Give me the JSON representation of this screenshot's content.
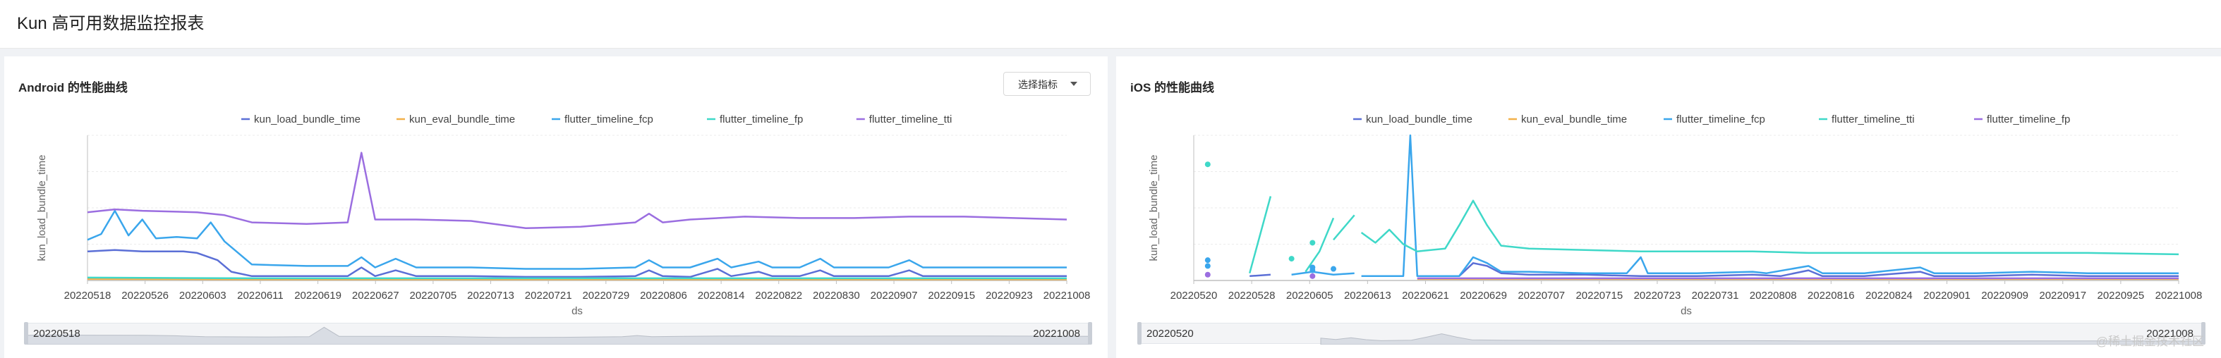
{
  "page": {
    "title": "Kun 高可用数据监控报表"
  },
  "watermark": "@稀土掘金技术社区",
  "panels": {
    "left": {
      "title": "Android 的性能曲线",
      "select_label": "选择指标",
      "slider": {
        "start": "20220518",
        "end": "20221008"
      }
    },
    "right": {
      "title": "iOS 的性能曲线",
      "slider": {
        "start": "20220520",
        "end": "20221008"
      }
    }
  },
  "colors": {
    "purple": "#9b6ee0",
    "blue": "#3aa6ec",
    "navy": "#5b6fd6",
    "teal": "#3fd8c8",
    "orange": "#f2b04a",
    "grid": "#ebebeb"
  },
  "chart_data": [
    {
      "type": "line",
      "ylabel": "kun_load_bundle_time",
      "xlabel": "ds",
      "legend": "top",
      "grid": true,
      "x_ticks": [
        "20220518",
        "20220526",
        "20220603",
        "20220611",
        "20220619",
        "20220627",
        "20220705",
        "20220713",
        "20220721",
        "20220729",
        "20220806",
        "20220814",
        "20220822",
        "20220830",
        "20220907",
        "20220915",
        "20220923",
        "20221008"
      ],
      "x_range": [
        "20220518",
        "20221008"
      ],
      "ylim": [
        0,
        100
      ],
      "series": [
        {
          "name": "kun_load_bundle_time",
          "color": "#5b6fd6",
          "points": [
            [
              "20220518",
              20
            ],
            [
              "20220522",
              21
            ],
            [
              "20220526",
              20
            ],
            [
              "20220601",
              20
            ],
            [
              "20220603",
              19
            ],
            [
              "20220606",
              14
            ],
            [
              "20220608",
              6
            ],
            [
              "20220611",
              3
            ],
            [
              "20220619",
              3
            ],
            [
              "20220625",
              3
            ],
            [
              "20220627",
              9
            ],
            [
              "20220629",
              3
            ],
            [
              "20220702",
              7
            ],
            [
              "20220705",
              3
            ],
            [
              "20220713",
              3
            ],
            [
              "20220721",
              2.5
            ],
            [
              "20220729",
              2.5
            ],
            [
              "20220806",
              3
            ],
            [
              "20220808",
              7
            ],
            [
              "20220810",
              3
            ],
            [
              "20220814",
              2.5
            ],
            [
              "20220818",
              8
            ],
            [
              "20220820",
              3
            ],
            [
              "20220824",
              6
            ],
            [
              "20220826",
              3
            ],
            [
              "20220830",
              3
            ],
            [
              "20220902",
              7
            ],
            [
              "20220904",
              3
            ],
            [
              "20220912",
              3
            ],
            [
              "20220915",
              7
            ],
            [
              "20220917",
              3
            ],
            [
              "20220923",
              3
            ],
            [
              "20221008",
              3
            ]
          ]
        },
        {
          "name": "kun_eval_bundle_time",
          "color": "#f2b04a",
          "points": [
            [
              "20220518",
              1
            ],
            [
              "20220611",
              0.8
            ],
            [
              "20220713",
              0.8
            ],
            [
              "20220814",
              0.8
            ],
            [
              "20220915",
              0.8
            ],
            [
              "20221008",
              0.8
            ]
          ]
        },
        {
          "name": "flutter_timeline_fcp",
          "color": "#3aa6ec",
          "points": [
            [
              "20220518",
              28
            ],
            [
              "20220520",
              32
            ],
            [
              "20220522",
              48
            ],
            [
              "20220524",
              31
            ],
            [
              "20220526",
              42
            ],
            [
              "20220528",
              29
            ],
            [
              "20220531",
              30
            ],
            [
              "20220603",
              29
            ],
            [
              "20220605",
              40
            ],
            [
              "20220607",
              27
            ],
            [
              "20220611",
              11
            ],
            [
              "20220619",
              10
            ],
            [
              "20220625",
              10
            ],
            [
              "20220627",
              16
            ],
            [
              "20220629",
              9
            ],
            [
              "20220702",
              15
            ],
            [
              "20220705",
              9
            ],
            [
              "20220713",
              9
            ],
            [
              "20220721",
              8
            ],
            [
              "20220729",
              8
            ],
            [
              "20220806",
              9
            ],
            [
              "20220808",
              14
            ],
            [
              "20220810",
              9
            ],
            [
              "20220814",
              9
            ],
            [
              "20220818",
              15
            ],
            [
              "20220820",
              9
            ],
            [
              "20220824",
              13
            ],
            [
              "20220826",
              9
            ],
            [
              "20220830",
              9
            ],
            [
              "20220902",
              15
            ],
            [
              "20220904",
              9
            ],
            [
              "20220912",
              9
            ],
            [
              "20220915",
              14
            ],
            [
              "20220917",
              9
            ],
            [
              "20220923",
              9
            ],
            [
              "20221008",
              9
            ]
          ]
        },
        {
          "name": "flutter_timeline_fp",
          "color": "#3fd8c8",
          "points": [
            [
              "20220518",
              2
            ],
            [
              "20220611",
              1.5
            ],
            [
              "20220713",
              1.5
            ],
            [
              "20220814",
              1.5
            ],
            [
              "20220915",
              1.5
            ],
            [
              "20221008",
              1.5
            ]
          ]
        },
        {
          "name": "flutter_timeline_tti",
          "color": "#9b6ee0",
          "points": [
            [
              "20220518",
              47
            ],
            [
              "20220522",
              49
            ],
            [
              "20220526",
              48
            ],
            [
              "20220603",
              47
            ],
            [
              "20220607",
              45
            ],
            [
              "20220611",
              40
            ],
            [
              "20220619",
              39
            ],
            [
              "20220625",
              40
            ],
            [
              "20220627",
              88
            ],
            [
              "20220629",
              42
            ],
            [
              "20220705",
              42
            ],
            [
              "20220713",
              41
            ],
            [
              "20220721",
              36
            ],
            [
              "20220729",
              37
            ],
            [
              "20220806",
              40
            ],
            [
              "20220808",
              46
            ],
            [
              "20220810",
              40
            ],
            [
              "20220814",
              42
            ],
            [
              "20220822",
              44
            ],
            [
              "20220830",
              43
            ],
            [
              "20220907",
              43
            ],
            [
              "20220915",
              44
            ],
            [
              "20220923",
              44
            ],
            [
              "20221008",
              42
            ]
          ]
        }
      ]
    },
    {
      "type": "line",
      "ylabel": "kun_load_bundle_time",
      "xlabel": "ds",
      "legend": "top",
      "grid": true,
      "x_ticks": [
        "20220520",
        "20220528",
        "20220605",
        "20220613",
        "20220621",
        "20220629",
        "20220707",
        "20220715",
        "20220723",
        "20220731",
        "20220808",
        "20220816",
        "20220824",
        "20220901",
        "20220909",
        "20220917",
        "20220925",
        "20221008"
      ],
      "x_range": [
        "20220520",
        "20221008"
      ],
      "ylim": [
        0,
        100
      ],
      "series": [
        {
          "name": "kun_load_bundle_time",
          "color": "#5b6fd6",
          "points": [
            [
              "20220520",
              null
            ],
            [
              "20220621",
              3
            ],
            [
              "20220623",
              3
            ],
            [
              "20220627",
              3
            ],
            [
              "20220629",
              12
            ],
            [
              "20220701",
              10
            ],
            [
              "20220703",
              5
            ],
            [
              "20220707",
              4
            ],
            [
              "20220715",
              4
            ],
            [
              "20220723",
              3
            ],
            [
              "20220731",
              3
            ],
            [
              "20220808",
              4
            ],
            [
              "20220812",
              3
            ],
            [
              "20220816",
              7
            ],
            [
              "20220818",
              3
            ],
            [
              "20220824",
              3
            ],
            [
              "20220901",
              6
            ],
            [
              "20220903",
              3
            ],
            [
              "20220909",
              3
            ],
            [
              "20220917",
              4
            ],
            [
              "20220925",
              3
            ],
            [
              "20221008",
              3
            ]
          ]
        },
        {
          "name": "kun_eval_bundle_time",
          "color": "#f2b04a",
          "points": [
            [
              "20220621",
              1
            ],
            [
              "20220715",
              1
            ],
            [
              "20220808",
              1
            ],
            [
              "20220901",
              1
            ],
            [
              "20221008",
              1
            ]
          ]
        },
        {
          "name": "flutter_timeline_fcp",
          "color": "#3aa6ec",
          "points": [
            [
              "20220613",
              3
            ],
            [
              "20220619",
              3
            ],
            [
              "20220620",
              100
            ],
            [
              "20220621",
              3
            ],
            [
              "20220627",
              3
            ],
            [
              "20220629",
              16
            ],
            [
              "20220701",
              12
            ],
            [
              "20220703",
              6
            ],
            [
              "20220707",
              6
            ],
            [
              "20220715",
              5
            ],
            [
              "20220721",
              5
            ],
            [
              "20220723",
              16
            ],
            [
              "20220724",
              5
            ],
            [
              "20220731",
              5
            ],
            [
              "20220808",
              6
            ],
            [
              "20220810",
              5
            ],
            [
              "20220816",
              10
            ],
            [
              "20220818",
              5
            ],
            [
              "20220824",
              5
            ],
            [
              "20220901",
              9
            ],
            [
              "20220903",
              5
            ],
            [
              "20220909",
              5
            ],
            [
              "20220917",
              6
            ],
            [
              "20220925",
              5
            ],
            [
              "20221008",
              5
            ]
          ]
        },
        {
          "name": "flutter_timeline_tti",
          "color": "#3fd8c8",
          "points": [
            [
              "20220613",
              33
            ],
            [
              "20220615",
              26
            ],
            [
              "20220617",
              35
            ],
            [
              "20220619",
              25
            ],
            [
              "20220621",
              20
            ],
            [
              "20220625",
              22
            ],
            [
              "20220627",
              38
            ],
            [
              "20220629",
              55
            ],
            [
              "20220701",
              38
            ],
            [
              "20220703",
              24
            ],
            [
              "20220707",
              22
            ],
            [
              "20220715",
              21
            ],
            [
              "20220723",
              20
            ],
            [
              "20220731",
              20
            ],
            [
              "20220808",
              20
            ],
            [
              "20220816",
              19
            ],
            [
              "20220824",
              19
            ],
            [
              "20220901",
              19
            ],
            [
              "20220909",
              19
            ],
            [
              "20220917",
              19
            ],
            [
              "20220925",
              19
            ],
            [
              "20221008",
              18
            ]
          ]
        },
        {
          "name": "flutter_timeline_fp",
          "color": "#9b6ee0",
          "points": [
            [
              "20220621",
              1.5
            ],
            [
              "20220715",
              1.5
            ],
            [
              "20220808",
              1.5
            ],
            [
              "20220901",
              1.5
            ],
            [
              "20221008",
              1.5
            ]
          ]
        }
      ],
      "scatter": [
        {
          "color": "#3fd8c8",
          "points": [
            [
              "20220522",
              80
            ],
            [
              "20220606",
              26
            ],
            [
              "20220603",
              15
            ]
          ]
        },
        {
          "color": "#3aa6ec",
          "points": [
            [
              "20220522",
              14
            ],
            [
              "20220522",
              10
            ],
            [
              "20220606",
              9
            ],
            [
              "20220606",
              7
            ],
            [
              "20220609",
              8
            ]
          ]
        },
        {
          "color": "#9b6ee0",
          "points": [
            [
              "20220522",
              4
            ],
            [
              "20220606",
              3
            ]
          ]
        }
      ],
      "segments": [
        {
          "color": "#3fd8c8",
          "points": [
            [
              "20220528",
              5
            ],
            [
              "20220531",
              58
            ]
          ]
        },
        {
          "color": "#3fd8c8",
          "points": [
            [
              "20220605",
              6
            ],
            [
              "20220607",
              20
            ],
            [
              "20220609",
              43
            ]
          ]
        },
        {
          "color": "#3fd8c8",
          "points": [
            [
              "20220609",
              28
            ],
            [
              "20220612",
              45
            ]
          ]
        },
        {
          "color": "#3aa6ec",
          "points": [
            [
              "20220603",
              4
            ],
            [
              "20220606",
              6
            ],
            [
              "20220609",
              4
            ],
            [
              "20220612",
              5
            ]
          ]
        },
        {
          "color": "#5b6fd6",
          "points": [
            [
              "20220528",
              3
            ],
            [
              "20220531",
              4
            ]
          ]
        }
      ]
    }
  ]
}
